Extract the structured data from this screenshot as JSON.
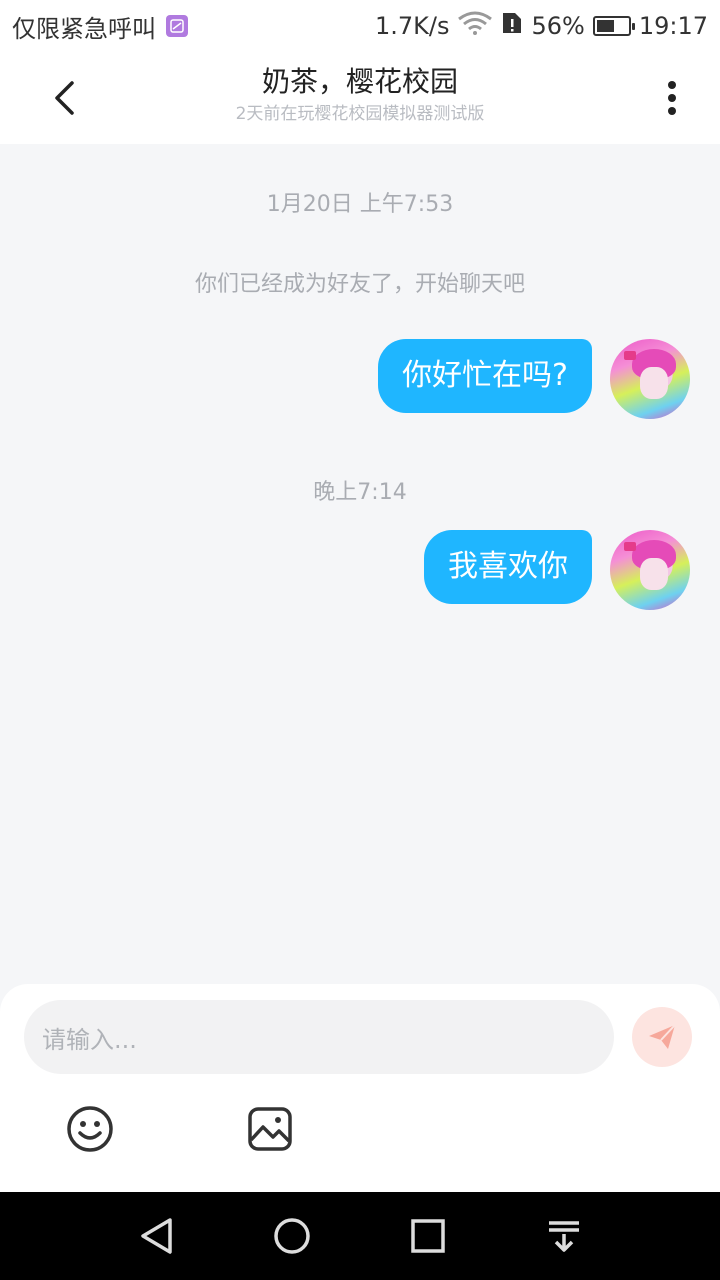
{
  "status_bar": {
    "carrier": "仅限紧急呼叫",
    "net_speed": "1.7K/s",
    "battery": "56%",
    "battery_level": 0.56,
    "time": "19:17"
  },
  "header": {
    "title": "奶茶，樱花校园",
    "subtitle": "2天前在玩樱花校园模拟器测试版"
  },
  "chat": {
    "items": [
      {
        "type": "timestamp",
        "text": "1月20日 上午7:53"
      },
      {
        "type": "system",
        "text": "你们已经成为好友了，开始聊天吧"
      },
      {
        "type": "message",
        "side": "right",
        "text": "你好忙在吗?"
      },
      {
        "type": "timestamp",
        "text": "晚上7:14"
      },
      {
        "type": "message",
        "side": "right",
        "text": "我喜欢你"
      }
    ]
  },
  "input": {
    "placeholder": "请输入..."
  },
  "colors": {
    "bubble": "#1fb6ff",
    "send_button_bg": "#fde4e0",
    "send_icon": "#f6a89b"
  },
  "icons": {
    "back": "chevron-left-icon",
    "more": "more-vertical-icon",
    "send": "send-icon",
    "emoji": "emoji-icon",
    "image": "image-icon"
  }
}
